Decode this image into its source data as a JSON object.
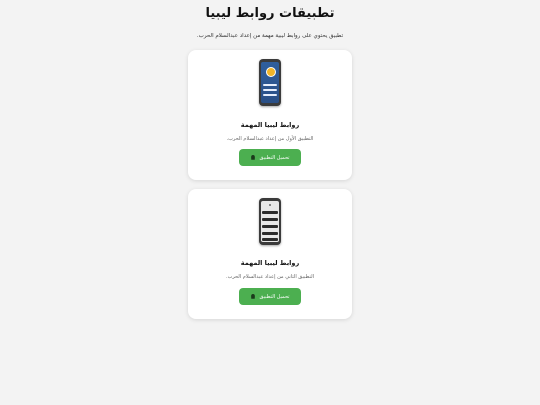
{
  "page": {
    "title": "تطبيقات روابط ليبيا",
    "subtitle": "تطبيق يحتوي على روابط ليبية مهمة من إعداد عبدالسلام الحرب."
  },
  "apps": [
    {
      "name": "روابط ليبيا المهمة",
      "description": "التطبيق الأول من إعداد عبدالسلام الحرب.",
      "download_label": "تحميل التطبيق",
      "icon": "android-icon"
    },
    {
      "name": "روابط ليبيا المهمة",
      "description": "التطبيق الثاني من إعداد عبدالسلام الحرب.",
      "download_label": "تحميل التطبيق",
      "icon": "android-icon"
    }
  ],
  "colors": {
    "background": "#f3f3f3",
    "card": "#ffffff",
    "button": "#4caf50"
  }
}
